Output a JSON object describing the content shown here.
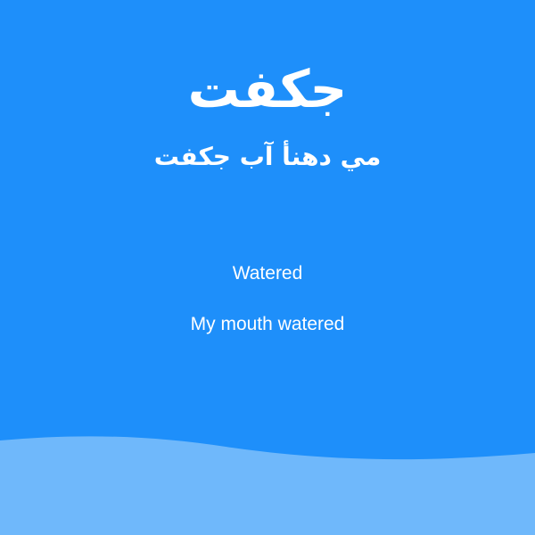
{
  "card": {
    "word_arabic": "جكفت",
    "sentence_arabic": "مي دهنأ آب جكفت",
    "word_translation": "Watered",
    "sentence_translation": "My mouth watered"
  },
  "colors": {
    "background": "#1e8ffa",
    "wave": "#6fb8fb",
    "text": "#ffffff"
  }
}
